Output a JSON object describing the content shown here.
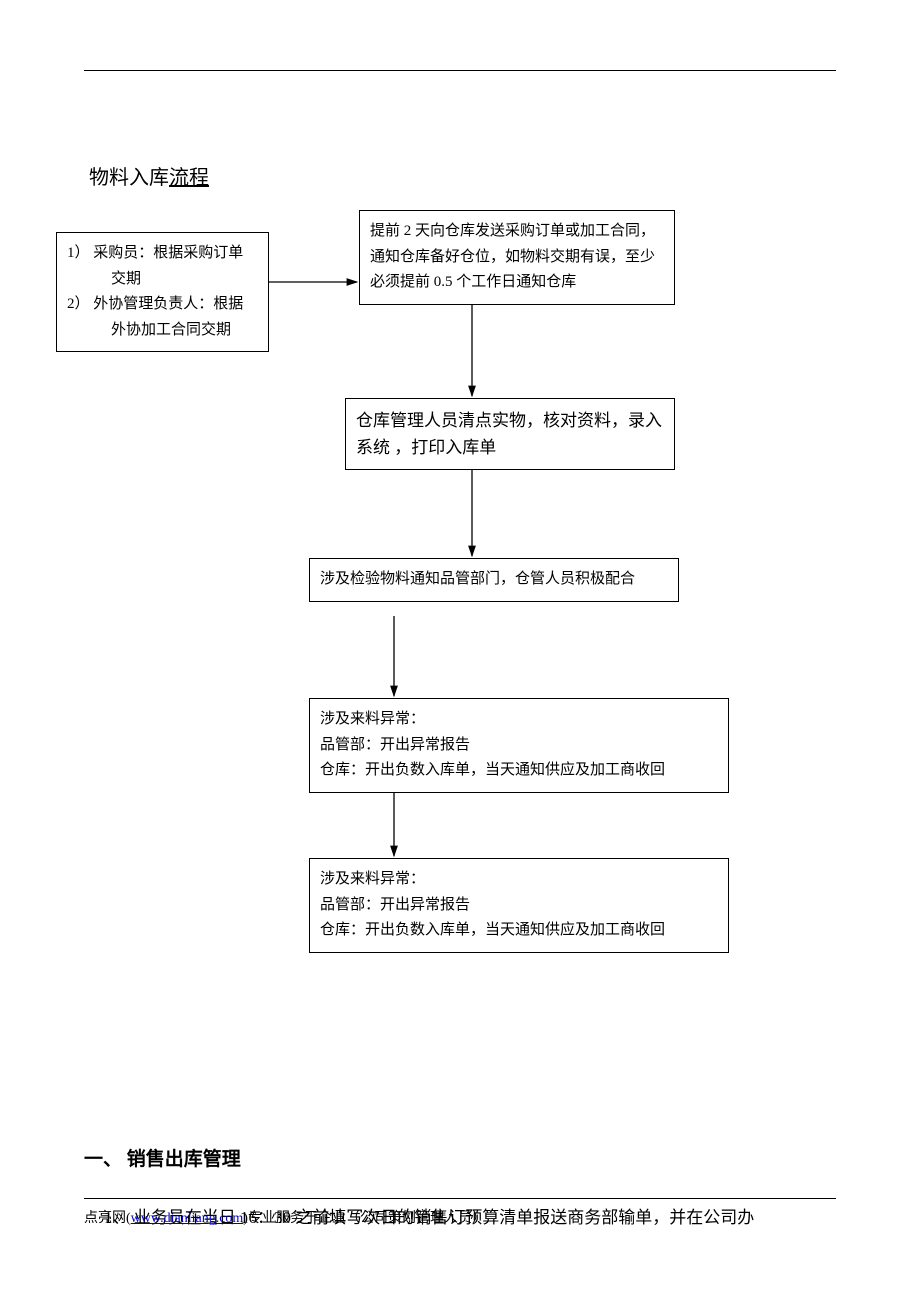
{
  "title": {
    "plain": "物料入库",
    "underlined": "流程"
  },
  "flow": {
    "box1": {
      "line1a": "1）  采购员：根据采购订单",
      "line1b": "交期",
      "line2a": "2）  外协管理负责人：根据",
      "line2b": "外协加工合同交期"
    },
    "box2": "提前 2 天向仓库发送采购订单或加工合同，通知仓库备好仓位，如物料交期有误，至少必须提前 0.5 个工作日通知仓库",
    "box3": "仓库管理人员清点实物，核对资料，录入系统 ，打印入库单",
    "box4": "涉及检验物料通知品管部门，仓管人员积极配合",
    "box5": {
      "l1": "涉及来料异常：",
      "l2": "品管部：开出异常报告",
      "l3": "仓库：开出负数入库单，当天通知供应及加工商收回"
    },
    "box6": {
      "l1": "涉及来料异常：",
      "l2": "品管部：开出异常报告",
      "l3": "仓库：开出负数入库单，当天通知供应及加工商收回"
    }
  },
  "section": {
    "heading": "一、 销售出库管理"
  },
  "paragraph": "1、 业务员在当日 16：30 之前填写次日的销售订预算清单报送商务部输单，并在公司办",
  "footer": {
    "pre": "点亮网(",
    "link_text": "www.dianliang.com",
    "post": ")专业服务于企业（公司策划管理人员）"
  }
}
